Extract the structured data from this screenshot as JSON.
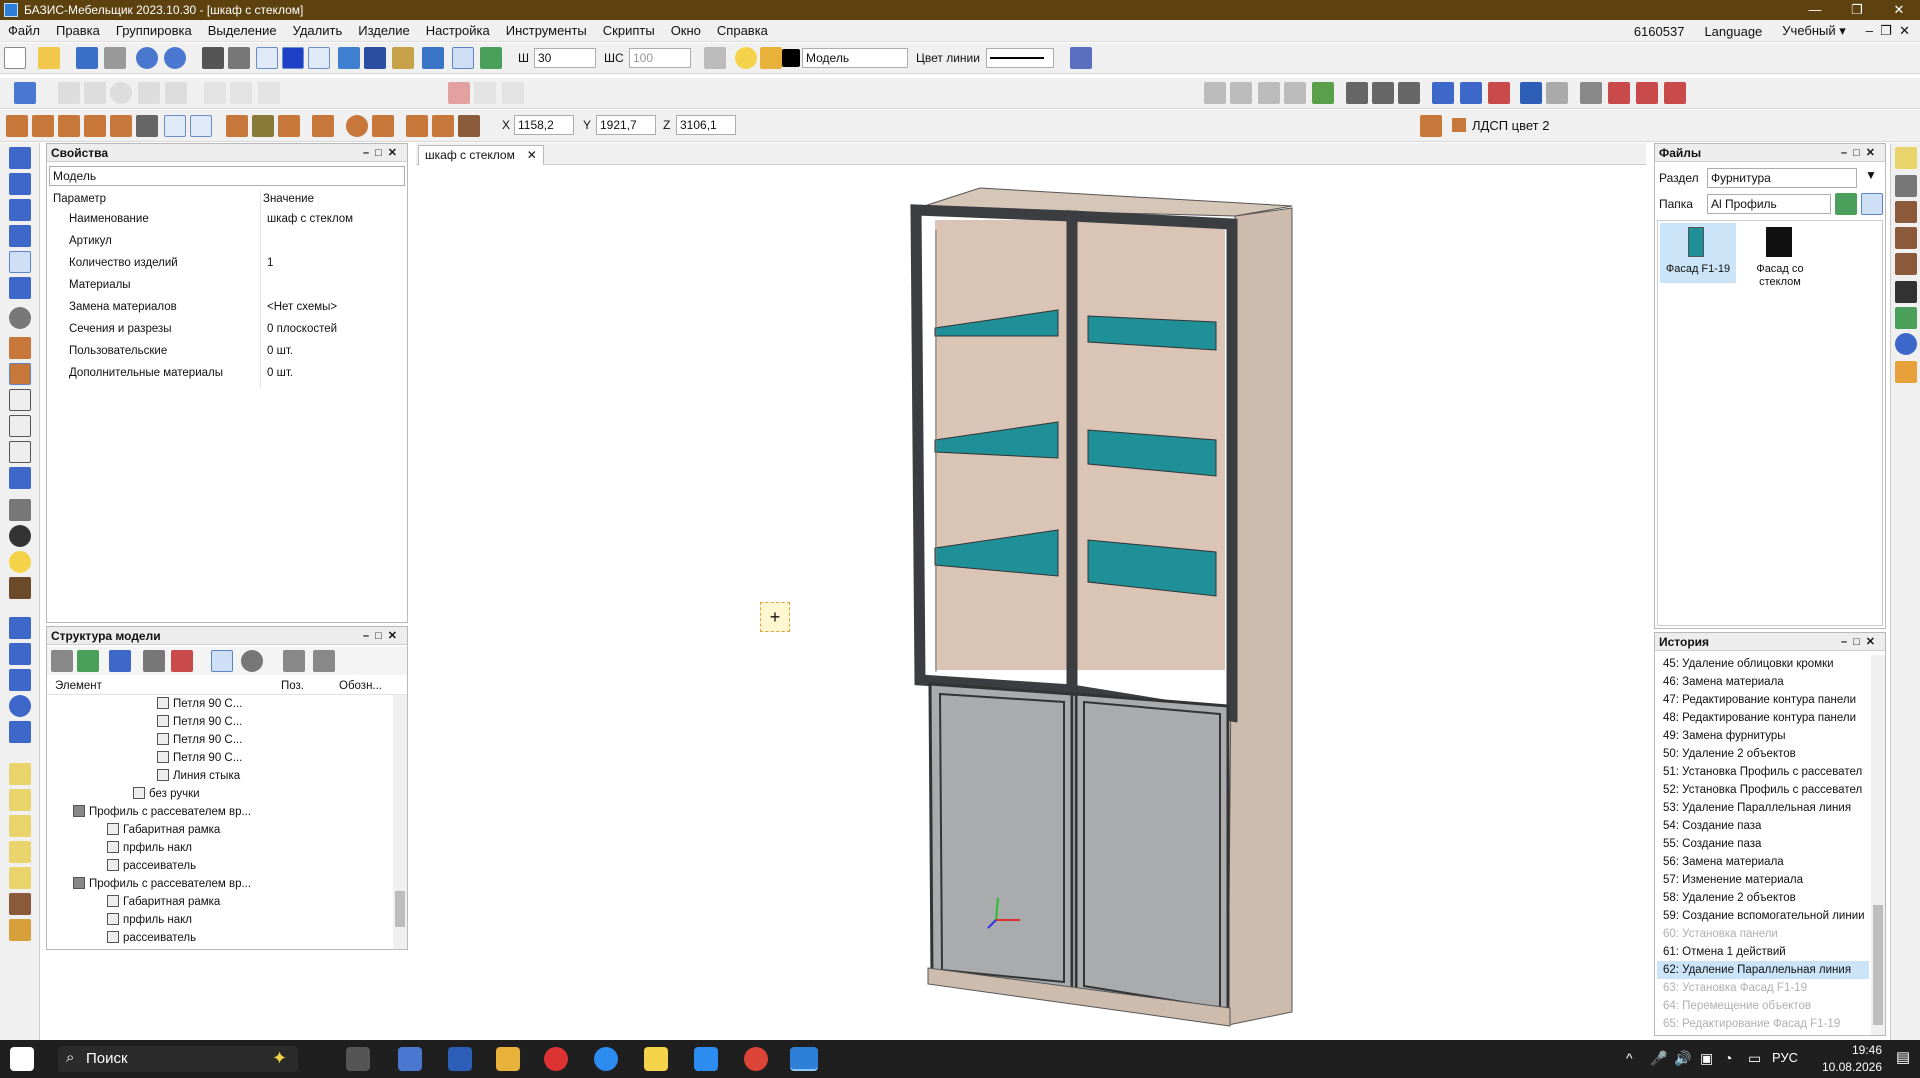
{
  "window": {
    "title": "БАЗИС-Мебельщик 2023.10.30 - [шкаф с стеклом]"
  },
  "menu": {
    "items": [
      "Файл",
      "Правка",
      "Группировка",
      "Выделение",
      "Удалить",
      "Изделие",
      "Настройка",
      "Инструменты",
      "Скрипты",
      "Окно",
      "Справка"
    ],
    "license": "6160537",
    "language": "Language",
    "mode": "Учебный ▾"
  },
  "toolbar1": {
    "w_label": "Ш",
    "w_value": "30",
    "ws_label": "ШС",
    "ws_value": "100",
    "layer": "Модель",
    "line_color_label": "Цвет линии"
  },
  "coords": {
    "x_label": "X",
    "x": "1158,2",
    "y_label": "Y",
    "y": "1921,7",
    "z_label": "Z",
    "z": "3106,1"
  },
  "material": {
    "current": "ЛДСП цвет 2"
  },
  "properties": {
    "title": "Свойства",
    "selector": "Модель",
    "col_param": "Параметр",
    "col_value": "Значение",
    "rows": [
      {
        "k": "Наименование",
        "v": "шкаф с стеклом"
      },
      {
        "k": "Артикул",
        "v": ""
      },
      {
        "k": "Количество изделий",
        "v": "1"
      },
      {
        "k": "Материалы",
        "v": ""
      },
      {
        "k": "Замена материалов",
        "v": "<Нет схемы>"
      },
      {
        "k": "Сечения и разрезы",
        "v": "0 плоскостей"
      },
      {
        "k": "Пользовательские",
        "v": "0 шт."
      },
      {
        "k": "Дополнительные материалы",
        "v": "0 шт."
      }
    ]
  },
  "structure": {
    "title": "Структура модели",
    "col_element": "Элемент",
    "col_pos": "Поз.",
    "col_desig": "Обозн...",
    "items": [
      {
        "t": "Петля 90 С...",
        "lvl": 4
      },
      {
        "t": "Петля 90 С...",
        "lvl": 4
      },
      {
        "t": "Петля 90 С...",
        "lvl": 4
      },
      {
        "t": "Петля 90 С...",
        "lvl": 4
      },
      {
        "t": "Линия стыка",
        "lvl": 4
      },
      {
        "t": "без ручки",
        "lvl": 3
      },
      {
        "t": "Профиль с рассевателем вр...",
        "lvl": 1
      },
      {
        "t": "Габаритная рамка",
        "lvl": 2
      },
      {
        "t": "прфиль накл",
        "lvl": 2
      },
      {
        "t": "рассеиватель",
        "lvl": 2
      },
      {
        "t": "Профиль с рассевателем вр...",
        "lvl": 1
      },
      {
        "t": "Габаритная рамка",
        "lvl": 2
      },
      {
        "t": "прфиль накл",
        "lvl": 2
      },
      {
        "t": "рассеиватель",
        "lvl": 2
      }
    ]
  },
  "document_tab": {
    "label": "шкаф с стеклом"
  },
  "files": {
    "title": "Файлы",
    "section_label": "Раздел",
    "section": "Фурнитура",
    "folder_label": "Папка",
    "folder": "Al Профиль",
    "items": [
      {
        "name": "Фасад F1-19",
        "color": "#1f8f98"
      },
      {
        "name": "Фасад со стеклом",
        "color": "#111111"
      }
    ]
  },
  "history": {
    "title": "История",
    "items": [
      {
        "t": "45:  Удаление облицовки кромки",
        "s": "n"
      },
      {
        "t": "46:  Замена материала",
        "s": "n"
      },
      {
        "t": "47:  Редактирование контура панели",
        "s": "n"
      },
      {
        "t": "48:  Редактирование контура панели",
        "s": "n"
      },
      {
        "t": "49:  Замена фурнитуры",
        "s": "n"
      },
      {
        "t": "50:  Удаление 2 объектов",
        "s": "n"
      },
      {
        "t": "51:  Установка Профиль с рассевател",
        "s": "n"
      },
      {
        "t": "52:  Установка Профиль с рассевател",
        "s": "n"
      },
      {
        "t": "53:  Удаление Параллельная линия",
        "s": "n"
      },
      {
        "t": "54:  Создание паза",
        "s": "n"
      },
      {
        "t": "55:  Создание паза",
        "s": "n"
      },
      {
        "t": "56:  Замена материала",
        "s": "n"
      },
      {
        "t": "57:  Изменение материала",
        "s": "n"
      },
      {
        "t": "58:  Удаление 2 объектов",
        "s": "n"
      },
      {
        "t": "59:  Создание вспомогательной линии",
        "s": "n"
      },
      {
        "t": "60:  Установка панели",
        "s": "g"
      },
      {
        "t": "61:  Отмена 1 действий",
        "s": "n"
      },
      {
        "t": "62:  Удаление Параллельная линия",
        "s": "sel"
      },
      {
        "t": "63:  Установка Фасад F1-19",
        "s": "g"
      },
      {
        "t": "64:  Перемещение объектов",
        "s": "g"
      },
      {
        "t": "65:  Редактирование Фасад F1-19",
        "s": "g"
      }
    ]
  },
  "taskbar": {
    "search": "Поиск",
    "lang": "РУС",
    "time": "19:46",
    "date": "10.08.2026"
  },
  "colors": {
    "title_bg": "#5d420f",
    "shelf": "#1f8f98",
    "frame": "#3b3d40",
    "carcass": "#cdbcad",
    "door": "#a9abac",
    "selection": "#cce4f7"
  }
}
